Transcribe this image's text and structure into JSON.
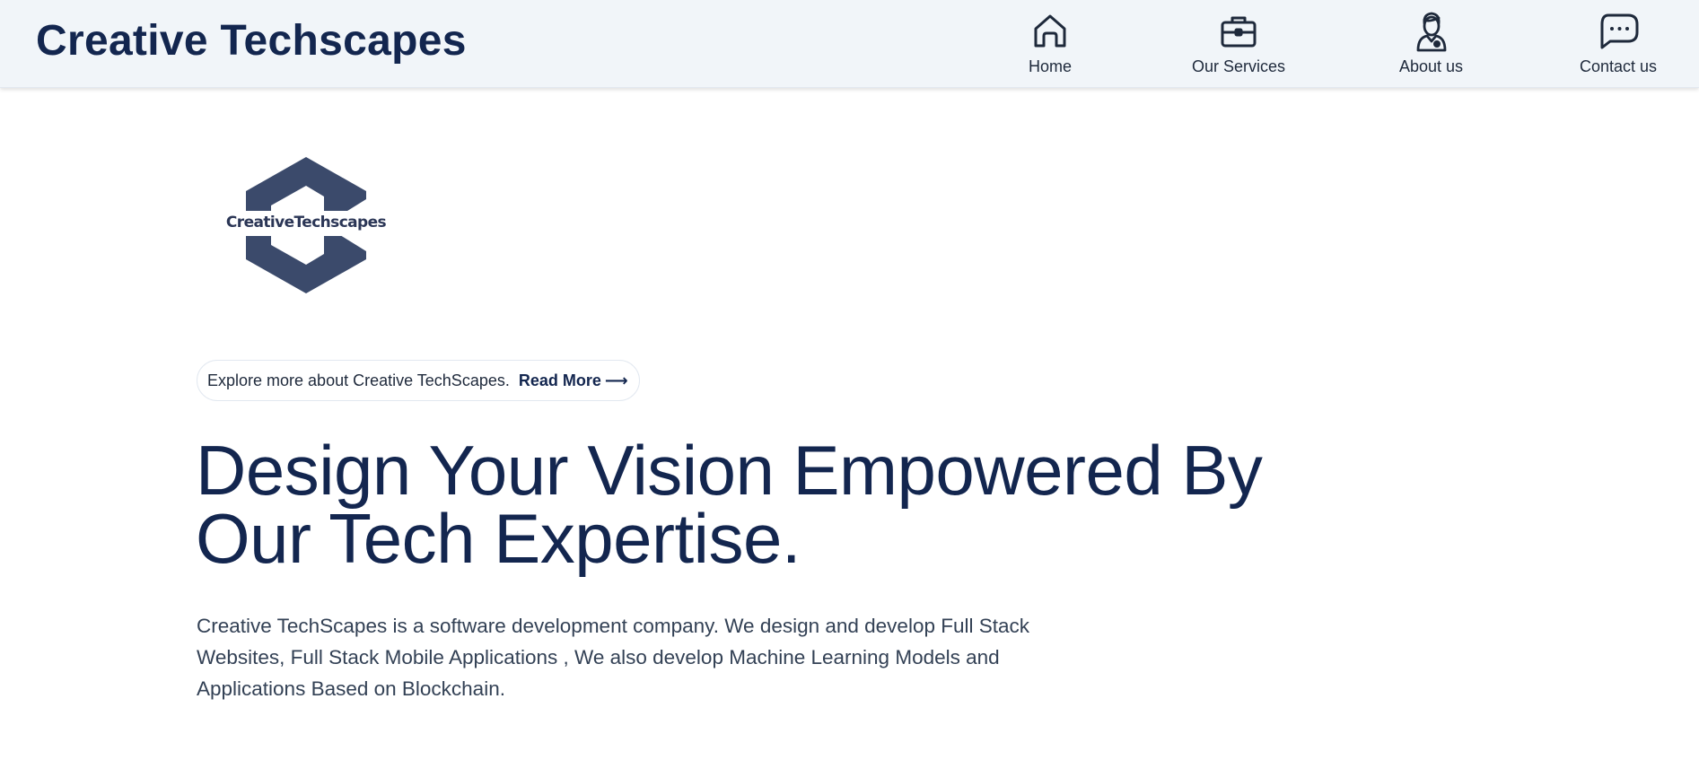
{
  "header": {
    "brand": "Creative Techscapes",
    "nav": [
      {
        "label": "Home",
        "icon": "home-icon"
      },
      {
        "label": "Our Services",
        "icon": "briefcase-icon"
      },
      {
        "label": "About us",
        "icon": "person-icon"
      },
      {
        "label": "Contact us",
        "icon": "chat-bubble-icon"
      }
    ]
  },
  "hero": {
    "logo_text": "CreativeTechscapes",
    "pill_text": "Explore more about Creative TechScapes.",
    "read_more": "Read More",
    "arrow": "⟶",
    "headline_line1": "Design Your Vision Empowered By",
    "headline_line2": "Our Tech Expertise.",
    "description": "Creative TechScapes is a software development company. We design and develop Full Stack Websites, Full Stack Mobile Applications , We also develop Machine Learning Models and Applications Based on Blockchain."
  },
  "colors": {
    "primary": "#13264f",
    "header_bg": "#f1f5f9",
    "logo": "#3b4a6b",
    "text": "#334155"
  }
}
